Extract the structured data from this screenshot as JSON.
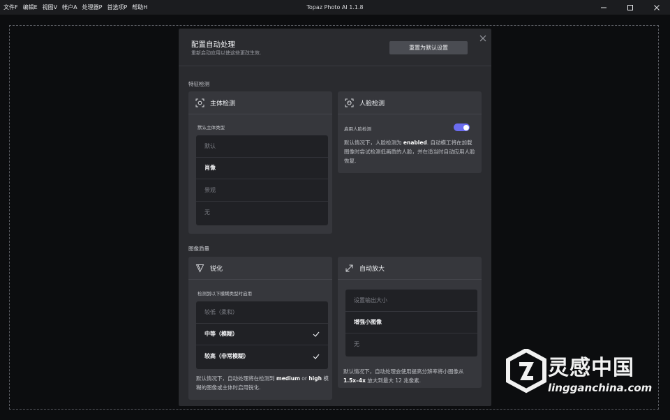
{
  "app": {
    "title": "Topaz Photo AI 1.1.8",
    "menus": [
      "文件F",
      "编辑E",
      "视图V",
      "帐户A",
      "处理器P",
      "首选项P",
      "帮助H"
    ]
  },
  "dialog": {
    "title": "配置自动处理",
    "subtitle": "重新启动应用以使这些更改生效.",
    "reset_label": "重置为默认设置",
    "sections": {
      "feature_detection": "特征检测",
      "image_quality": "图像质量"
    },
    "subject": {
      "title": "主体检测",
      "label": "默认主体类型",
      "options": [
        "默认",
        "肖像",
        "景观",
        "无"
      ]
    },
    "face": {
      "title": "人脸检测",
      "label": "启用人脸检测",
      "enabled": true,
      "desc_1": "默认情况下，人脸检测为",
      "desc_bold": "enabled",
      "desc_2": ". 自动模工将在加载图像时尝试检测低画质的人脸，并在适当时自动应用人脸恢复."
    },
    "sharpen": {
      "title": "锐化",
      "label": "检测到以下模糊类型时启用",
      "options": [
        "较低（柔和）",
        "中等（模糊）",
        "较高（非常模糊）"
      ],
      "checked": [
        false,
        true,
        true
      ],
      "desc_1": "默认情况下，自动处理将在检测到",
      "desc_b1": "medium",
      "desc_or": " or ",
      "desc_b2": "high",
      "desc_2": "模糊的图像或主体时启用锐化."
    },
    "upscale": {
      "title": "自动放大",
      "options": [
        "设置输出大小",
        "增强小图像",
        "无"
      ],
      "desc_1": "默认情况下，自动处理会使用提高分辨率将小图像从",
      "desc_bold": "1.5x–4x",
      "desc_2": " 放大到最大 12 兆像素."
    }
  },
  "watermark": {
    "text": "灵感中国",
    "url": "lingganchina.com"
  }
}
